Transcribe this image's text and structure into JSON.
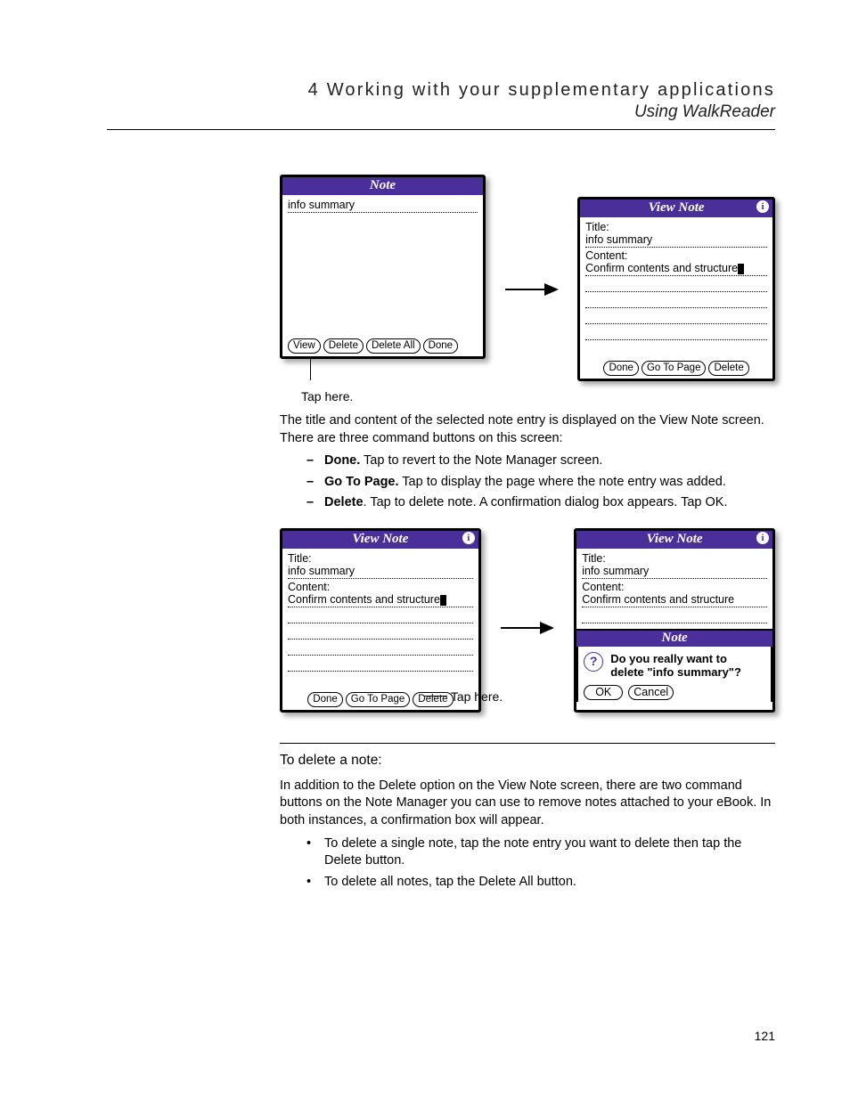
{
  "header": {
    "title": "4 Working with your supplementary applications",
    "subtitle": "Using WalkReader"
  },
  "fig1": {
    "left": {
      "title": "Note",
      "line1": "info summary",
      "buttons": [
        "View",
        "Delete",
        "Delete All",
        "Done"
      ]
    },
    "right": {
      "title": "View Note",
      "title_label": "Title:",
      "title_val": "info summary",
      "content_label": "Content:",
      "content_val": "Confirm contents and structure",
      "buttons": [
        "Done",
        "Go To Page",
        "Delete"
      ]
    },
    "caption": "Tap here."
  },
  "para1": "The title and content of the selected note entry is displayed on the View Note screen. There are three command buttons on this screen:",
  "commands": [
    {
      "name": "Done.",
      "desc": " Tap to revert to the Note Manager screen."
    },
    {
      "name": "Go To Page.",
      "desc": " Tap to display the page where the note entry was added."
    },
    {
      "name": "Delete",
      "desc": ". Tap to delete note. A confirmation dialog box appears. Tap OK."
    }
  ],
  "fig2": {
    "left": {
      "title": "View Note",
      "title_label": "Title:",
      "title_val": "info summary",
      "content_label": "Content:",
      "content_val": "Confirm contents and structure",
      "buttons": [
        "Done",
        "Go To Page",
        "Delete"
      ]
    },
    "right": {
      "title": "View Note",
      "title_label": "Title:",
      "title_val": "info summary",
      "content_label": "Content:",
      "content_val": "Confirm contents and structure",
      "dialog_title": "Note",
      "dialog_msg_l1": "Do you really want to",
      "dialog_msg_l2": "delete \"info summary\"?",
      "dialog_btns": [
        "OK",
        "Cancel"
      ]
    },
    "side_caption": "Tap here."
  },
  "heading2": "To delete a note:",
  "para2": "In addition to the Delete option on the View Note screen, there are two command buttons on the Note Manager you can use to remove notes attached to your eBook. In both instances, a confirmation box will appear.",
  "bullets2": [
    "To delete a single note, tap the note entry you want to delete then tap the Delete button.",
    "To delete all notes, tap the Delete All button."
  ],
  "page_num": "121"
}
